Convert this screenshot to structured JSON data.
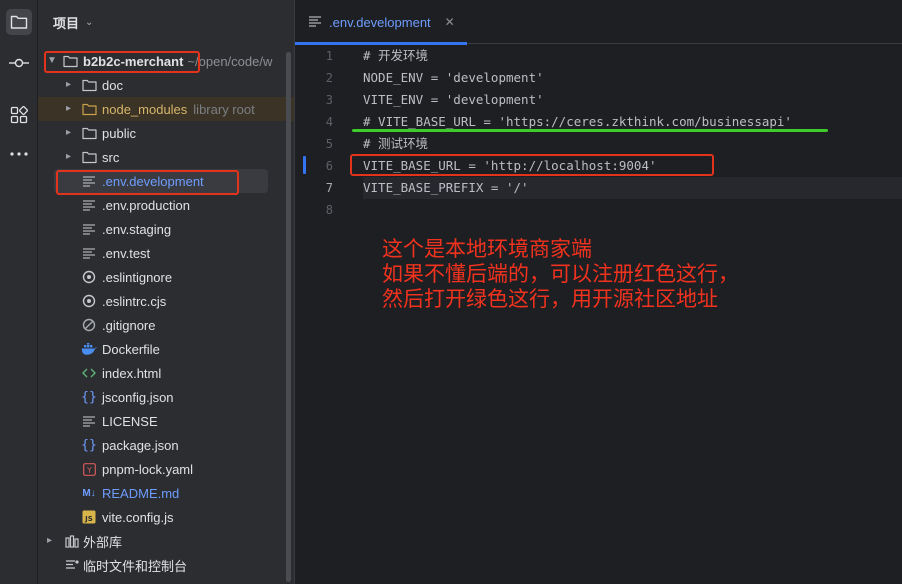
{
  "project_panel": {
    "title": "项目",
    "root": {
      "name": "b2b2c-merchant",
      "path": "~/open/code/w"
    },
    "items": [
      {
        "label": "doc",
        "type": "folder"
      },
      {
        "label": "node_modules",
        "type": "folder",
        "suffix": "library root"
      },
      {
        "label": "public",
        "type": "folder"
      },
      {
        "label": "src",
        "type": "folder"
      },
      {
        "label": ".env.development",
        "type": "text-file",
        "selected": true
      },
      {
        "label": ".env.production",
        "type": "text-file"
      },
      {
        "label": ".env.staging",
        "type": "text-file"
      },
      {
        "label": ".env.test",
        "type": "text-file"
      },
      {
        "label": ".eslintignore",
        "type": "eslint-file"
      },
      {
        "label": ".eslintrc.cjs",
        "type": "eslint-file"
      },
      {
        "label": ".gitignore",
        "type": "ignore-file"
      },
      {
        "label": "Dockerfile",
        "type": "docker-file"
      },
      {
        "label": "index.html",
        "type": "html-file"
      },
      {
        "label": "jsconfig.json",
        "type": "json-file"
      },
      {
        "label": "LICENSE",
        "type": "text-file"
      },
      {
        "label": "package.json",
        "type": "json-file"
      },
      {
        "label": "pnpm-lock.yaml",
        "type": "yaml-file"
      },
      {
        "label": "README.md",
        "type": "markdown-file"
      },
      {
        "label": "vite.config.js",
        "type": "js-file"
      }
    ],
    "external_libraries": "外部库",
    "scratches": "临时文件和控制台"
  },
  "editor": {
    "tab_label": ".env.development",
    "lines": [
      {
        "n": "1",
        "text": "# 开发环境"
      },
      {
        "n": "2",
        "text": "NODE_ENV = 'development'"
      },
      {
        "n": "3",
        "text": "VITE_ENV = 'development'"
      },
      {
        "n": "4",
        "text": "# VITE_BASE_URL = 'https://ceres.zkthink.com/businessapi'"
      },
      {
        "n": "5",
        "text": "# 测试环境"
      },
      {
        "n": "6",
        "text": "VITE_BASE_URL = 'http://localhost:9004'"
      },
      {
        "n": "7",
        "text": "VITE_BASE_PREFIX = '/'"
      },
      {
        "n": "8",
        "text": ""
      }
    ]
  },
  "annotation": {
    "lines": [
      "这个是本地环境商家端",
      "如果不懂后端的，可以注册红色这行，",
      "然后打开绿色这行，用开源社区地址"
    ],
    "colors": {
      "red": "#e2341d",
      "green": "#3ecb2c",
      "text": "#f0321e"
    }
  },
  "colors": {
    "accent": "#3574f0",
    "tab_text": "#6e9dff",
    "panel_bg": "#2b2d30",
    "editor_bg": "#1e1f22"
  }
}
